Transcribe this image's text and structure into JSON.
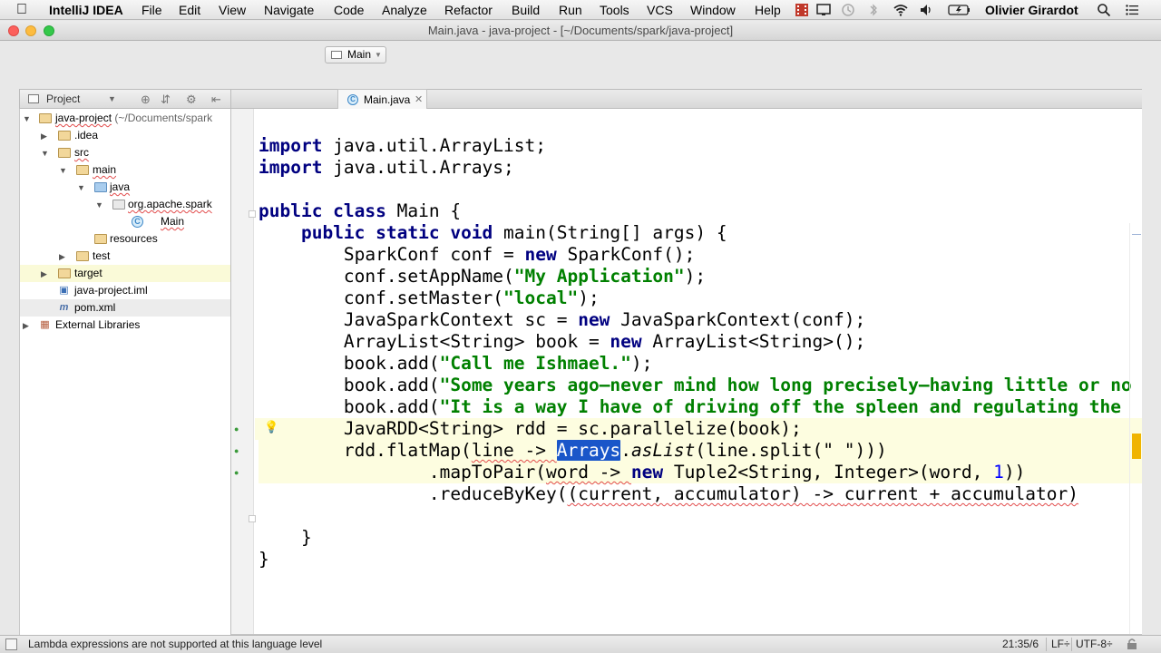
{
  "menubar": {
    "app_name": "IntelliJ IDEA",
    "items": [
      "File",
      "Edit",
      "View",
      "Navigate",
      "Code",
      "Analyze",
      "Refactor",
      "Build",
      "Run",
      "Tools",
      "VCS",
      "Window",
      "Help"
    ],
    "user": "Olivier Girardot"
  },
  "window": {
    "title": "Main.java - java-project - [~/Documents/spark/java-project]"
  },
  "toolbar": {
    "run_config": "Main"
  },
  "project_panel": {
    "header_label": "Project",
    "tree": [
      {
        "label": "java-project",
        "suffix": " (~/Documents/spark"
      },
      {
        "label": ".idea"
      },
      {
        "label": "src"
      },
      {
        "label": "main"
      },
      {
        "label": "java"
      },
      {
        "label": "org.apache.spark"
      },
      {
        "label": "Main"
      },
      {
        "label": "resources"
      },
      {
        "label": "test"
      },
      {
        "label": "target"
      },
      {
        "label": "java-project.iml"
      },
      {
        "label": "pom.xml"
      },
      {
        "label": "External Libraries"
      }
    ]
  },
  "editor": {
    "tab_label": "Main.java",
    "code": {
      "l1_kw": "import",
      "l1_rest": " java.util.ArrayList;",
      "l2_kw": "import",
      "l2_rest": " java.util.Arrays;",
      "l4_kw": "public class",
      "l4_rest": " Main {",
      "l5_kw": "public static void",
      "l5_rest": " main(String[] args) {",
      "l6_a": "SparkConf conf = ",
      "l6_kw": "new",
      "l6_b": " SparkConf();",
      "l7_a": "conf.setAppName(",
      "l7_str": "\"My Application\"",
      "l7_b": ");",
      "l8_a": "conf.setMaster(",
      "l8_str": "\"local\"",
      "l8_b": ");",
      "l9_a": "JavaSparkContext sc = ",
      "l9_kw": "new",
      "l9_b": " JavaSparkContext(conf);",
      "l10_a": "ArrayList<String> book = ",
      "l10_kw": "new",
      "l10_b": " ArrayList<String>();",
      "l11_a": "book.add(",
      "l11_str": "\"Call me Ishmael.\"",
      "l11_b": ");",
      "l12_a": "book.add(",
      "l12_str": "\"Some years ago—never mind how long precisely—having little or no",
      "l13_a": "book.add(",
      "l13_str": "\"It is a way I have of driving off the spleen and regulating the",
      "l14": "JavaRDD<String> rdd = sc.parallelize(book);",
      "l15_a": "rdd.flatMap(",
      "l15_err": "line -> ",
      "l15_hl": "Arrays",
      "l15_dot": ".",
      "l15_it": "asList",
      "l15_c": "(line.split(\" \")))",
      "l16_a": ".mapToPair(",
      "l16_err": "word -> ",
      "l16_kw": "new",
      "l16_b": " Tuple2<String, Integer>(word, ",
      "l16_num": "1",
      "l16_c": "))",
      "l17_a": ".reduceByKey(",
      "l17_err": "(current, accumulator) -> ",
      "l17_b": "current + accumulator)",
      "l19": "}",
      "l20": "}"
    }
  },
  "statusbar": {
    "message": "Lambda expressions are not supported at this language level",
    "position": "21:35/6",
    "line_sep": "LF÷",
    "encoding": "UTF-8÷"
  },
  "colors": {
    "keyword": "#000080",
    "string": "#008000",
    "selection": "#1a56c9",
    "current_line": "#fdfde0"
  }
}
